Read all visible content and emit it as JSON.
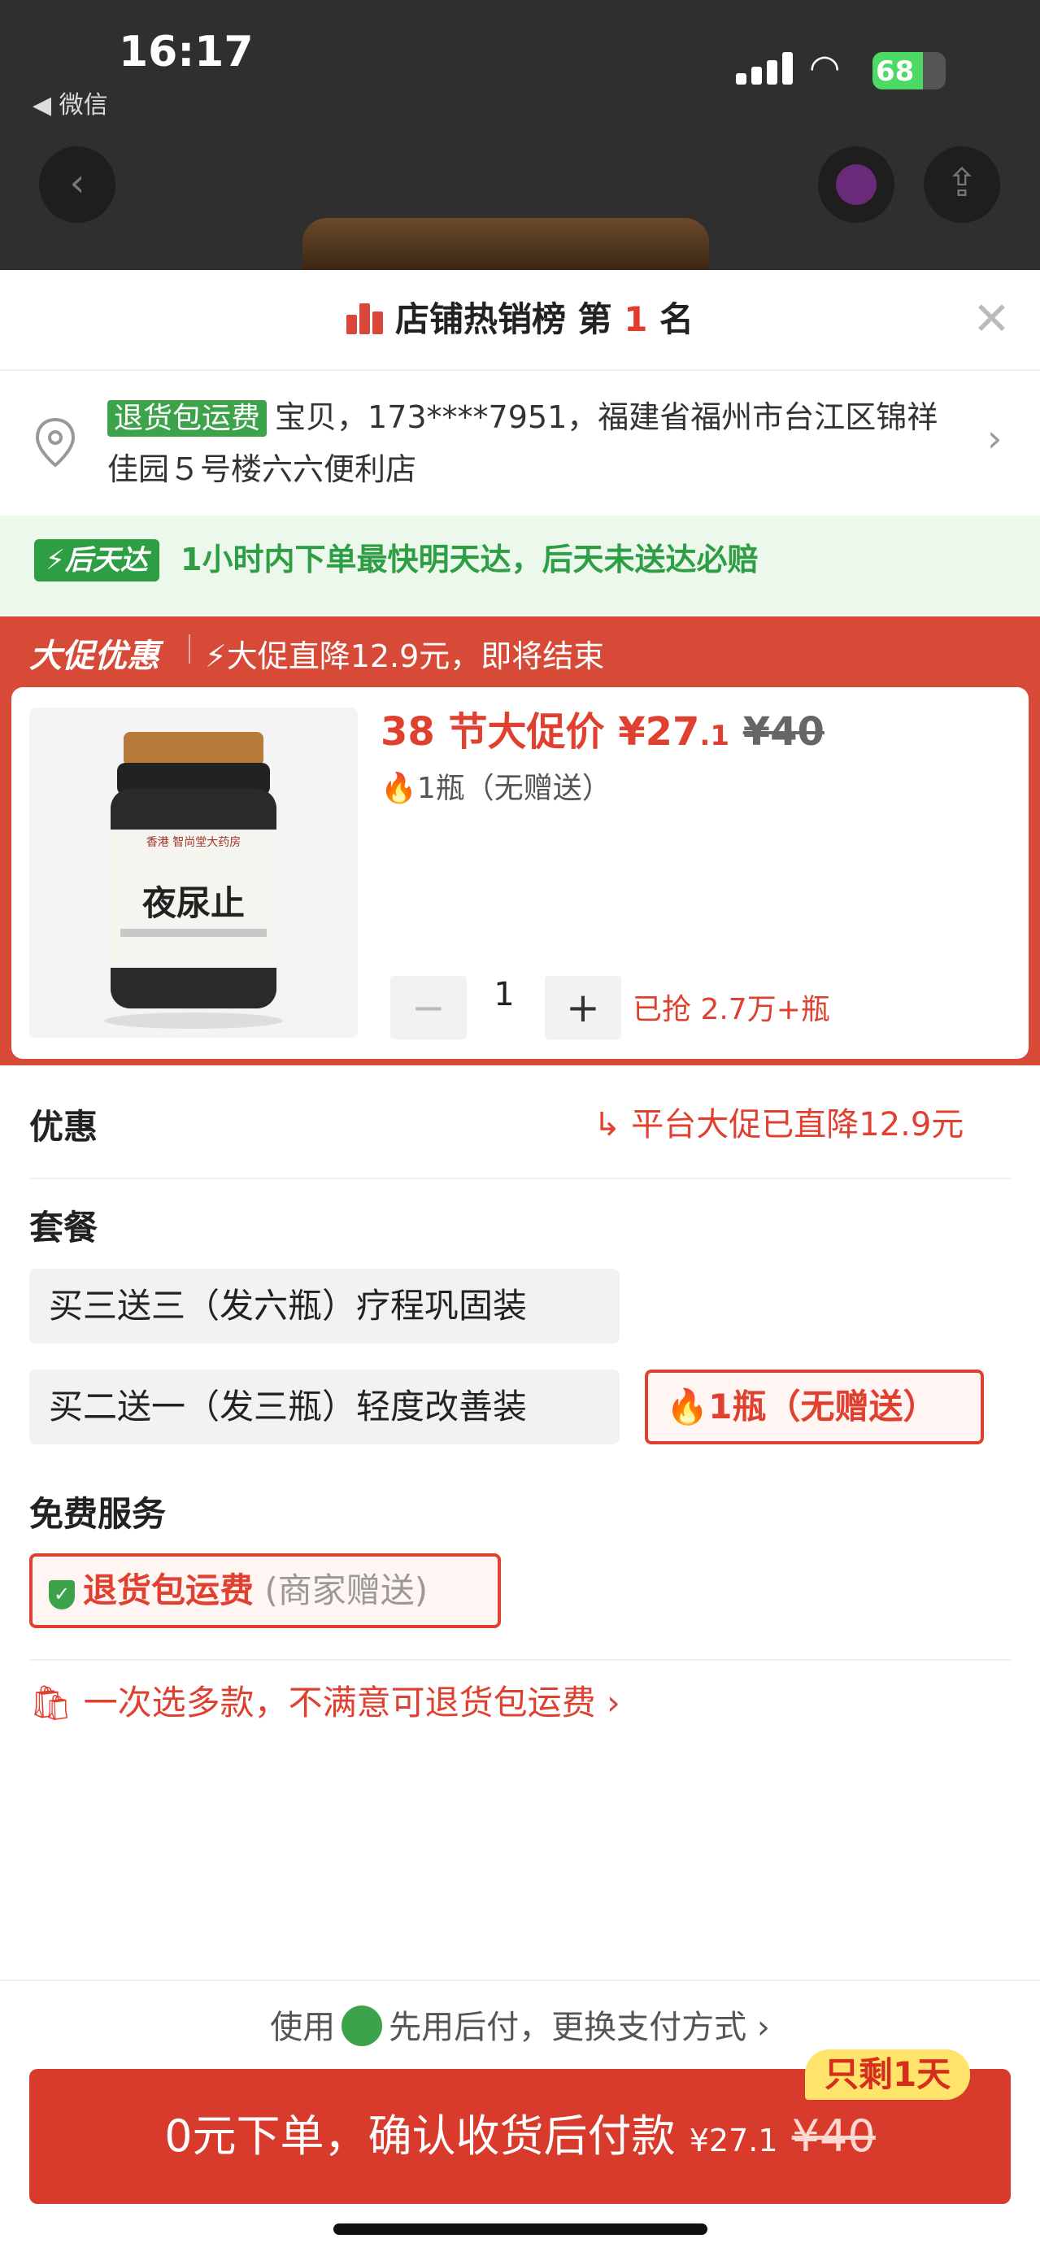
{
  "status_bar": {
    "time": "16:17",
    "back_app": "◀ 微信",
    "battery": "68"
  },
  "rank": {
    "prefix": "店铺热销榜 第 ",
    "number": "1",
    "suffix": " 名"
  },
  "address": {
    "tag": "退货包运费",
    "text": "宝贝，173****7951，福建省福州市台江区锦祥佳园５号楼六六便利店"
  },
  "delivery": {
    "tag": "后天达",
    "text": "1小时内下单最快明天达，后天未送达必赔"
  },
  "promo": {
    "header": "大促优惠",
    "subtitle": "大促直降12.9元，即将结束",
    "price_label": "38 节大促价 ¥27",
    "price_decimal": ".1",
    "old_price": "¥40",
    "variant": "1瓶（无赠送）",
    "quantity": "1",
    "sold": "已抢 2.7万+瓶",
    "product_name": "夜尿止",
    "product_brand": "香港 智尚堂大药房"
  },
  "discount": {
    "title": "优惠",
    "note": "平台大促已直降12.9元"
  },
  "package": {
    "title": "套餐",
    "options": [
      "买三送三（发六瓶）疗程巩固装",
      "买二送一（发三瓶）轻度改善装",
      "1瓶（无赠送）"
    ]
  },
  "service": {
    "title": "免费服务",
    "label": "退货包运费",
    "gift": "(商家赠送)"
  },
  "multi_note": "一次选多款，不满意可退货包运费",
  "payment": {
    "prefix": "使用",
    "text": "先用后付，更换支付方式"
  },
  "cta": {
    "text": "0元下单，确认收货后付款 ",
    "price": "¥27",
    "price_decimal": ".1",
    "old_price": "¥40",
    "badge": "只剩1天"
  },
  "colors": {
    "accent": "#e0402f",
    "green": "#3da34a",
    "cta": "#d83a2c"
  }
}
